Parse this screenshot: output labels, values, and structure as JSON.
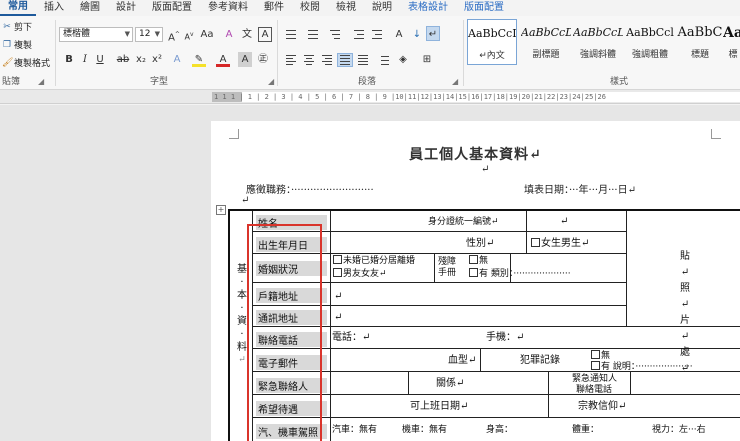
{
  "tabs": [
    "常用",
    "插入",
    "繪圖",
    "設計",
    "版面配置",
    "參考資料",
    "郵件",
    "校閱",
    "檢視",
    "說明",
    "表格設計",
    "版面配置"
  ],
  "clipboard": {
    "items": [
      "剪下",
      "複製",
      "複製格式"
    ],
    "label": "貼簿"
  },
  "font": {
    "name": "標楷體",
    "size": "12",
    "label": "字型",
    "grow": "A",
    "shrink": "A",
    "case": "Aa",
    "clear": "A",
    "phonetic": "文",
    "border": "A",
    "bold": "B",
    "italic": "I",
    "underline": "U",
    "strike": "ab",
    "sub": "x₂",
    "sup": "x²",
    "effects": "A",
    "highlight": "✎",
    "color": "A",
    "shade": "A",
    "circle": "㊣"
  },
  "paragraph": {
    "label": "段落",
    "asian": "A",
    "sort": "↓",
    "marks": "↵"
  },
  "styles": {
    "label": "樣式",
    "items": [
      {
        "preview": "AaBbCcI",
        "name": "↵內文"
      },
      {
        "preview": "AaBbCcD",
        "name": "副標題"
      },
      {
        "preview": "AaBbCcL",
        "name": "強調斜體"
      },
      {
        "preview": "AaBbCcl",
        "name": "強調粗體"
      },
      {
        "preview": "AaBbC",
        "name": "標題"
      },
      {
        "preview": "Aa",
        "name": "標"
      }
    ]
  },
  "ruler": {
    "ticks": "1 1 1 | 1 | 2 | 3 | 4 | 5 | 6 | 7 | 8 | 9 |10|11|12|13|14|15|16|17|18|19|20|21|22|23|24|25|26"
  },
  "document": {
    "title": "員工個人基本資料↵",
    "ret": "↵",
    "apply": "應徵職務：··························",
    "fill_date": "填表日期：···年···月···日↵",
    "section_label": [
      "基",
      "·",
      "本",
      "·",
      "資",
      "·",
      "料"
    ],
    "section_ret": "↵",
    "photo": [
      "貼↵",
      "照↵",
      "片↵",
      "處↵"
    ],
    "rows": [
      {
        "label": "姓名",
        "content": "身分證統一編號↵",
        "extra": "↵"
      },
      {
        "label": "出生年月日",
        "content": "性別↵",
        "extra": "女生男生↵"
      },
      {
        "label": "婚姻狀況",
        "content": "未婚已婚分居離婚",
        "content2": "男友女友↵",
        "extra": "殘障手冊",
        "extra2": "無",
        "extra3": "有 類別：····················"
      },
      {
        "label": "戶籍地址",
        "content": "↵"
      },
      {
        "label": "通訊地址",
        "content": "↵"
      },
      {
        "label": "聯絡電話",
        "content": "電話：↵",
        "extra": "手機：↵"
      },
      {
        "label": "電子郵件",
        "content": "血型↵",
        "extra": "犯罪記錄",
        "extra2": "無",
        "extra3": "有 說明：····················"
      },
      {
        "label": "緊急聯絡人",
        "content": "關係↵",
        "extra": "緊急通知人",
        "extra2": "聯絡電話"
      },
      {
        "label": "希望待遇",
        "content": "可上班日期↵",
        "extra": "宗教信仰↵"
      },
      {
        "label": "汽、機車駕照",
        "content": "汽車：無有",
        "content2": "機車：無有",
        "extra": "身高：",
        "extra2": "體重：",
        "extra3": "視力：左···右"
      }
    ]
  },
  "colors": {
    "accent": "#1e5a9c",
    "highlight_box": "#d9342b",
    "label_shade": "#d9d9d9"
  }
}
